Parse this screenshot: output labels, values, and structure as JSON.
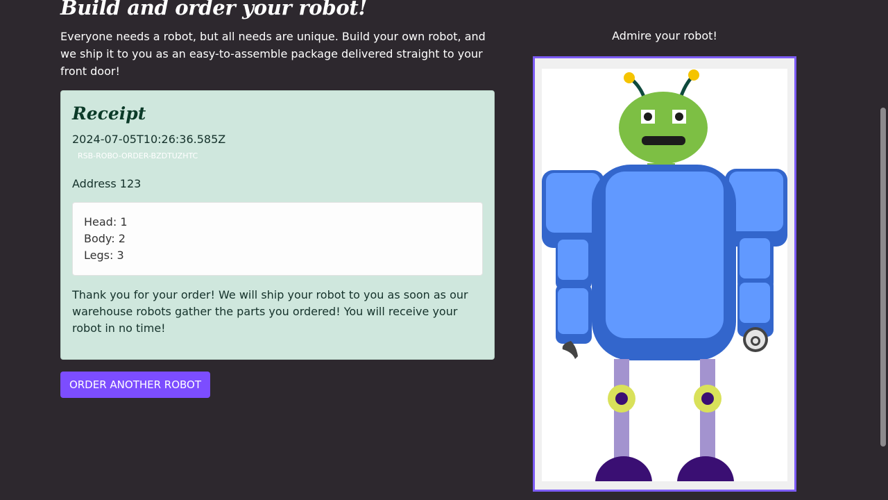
{
  "page": {
    "title": "Build and order your robot!",
    "intro": "Everyone needs a robot, but all needs are unique. Build your own robot, and we ship it to you as an easy-to-assemble package delivered straight to your front door!"
  },
  "receipt": {
    "title": "Receipt",
    "timestamp": "2024-07-05T10:26:36.585Z",
    "order_id": "RSB-ROBO-ORDER-BZDTUZHTC",
    "address": "Address 123",
    "parts": {
      "head": "Head: 1",
      "body": "Body: 2",
      "legs": "Legs: 3"
    },
    "thanks": "Thank you for your order! We will ship your robot to you as soon as our warehouse robots gather the parts you ordered! You will receive your robot in no time!"
  },
  "actions": {
    "order_another_label": "ORDER ANOTHER ROBOT"
  },
  "preview": {
    "title": "Admire your robot!"
  },
  "colors": {
    "background": "#2d282e",
    "accent": "#7c4dff",
    "receipt_bg": "#cfe7dd",
    "frame_border": "#7c5cf5",
    "robot_head": "#7dbf44",
    "robot_body": "#3d6fd6",
    "robot_legs": "#a393cf",
    "robot_feet": "#3a0f73"
  },
  "icons": {
    "robot": "robot-illustration"
  }
}
